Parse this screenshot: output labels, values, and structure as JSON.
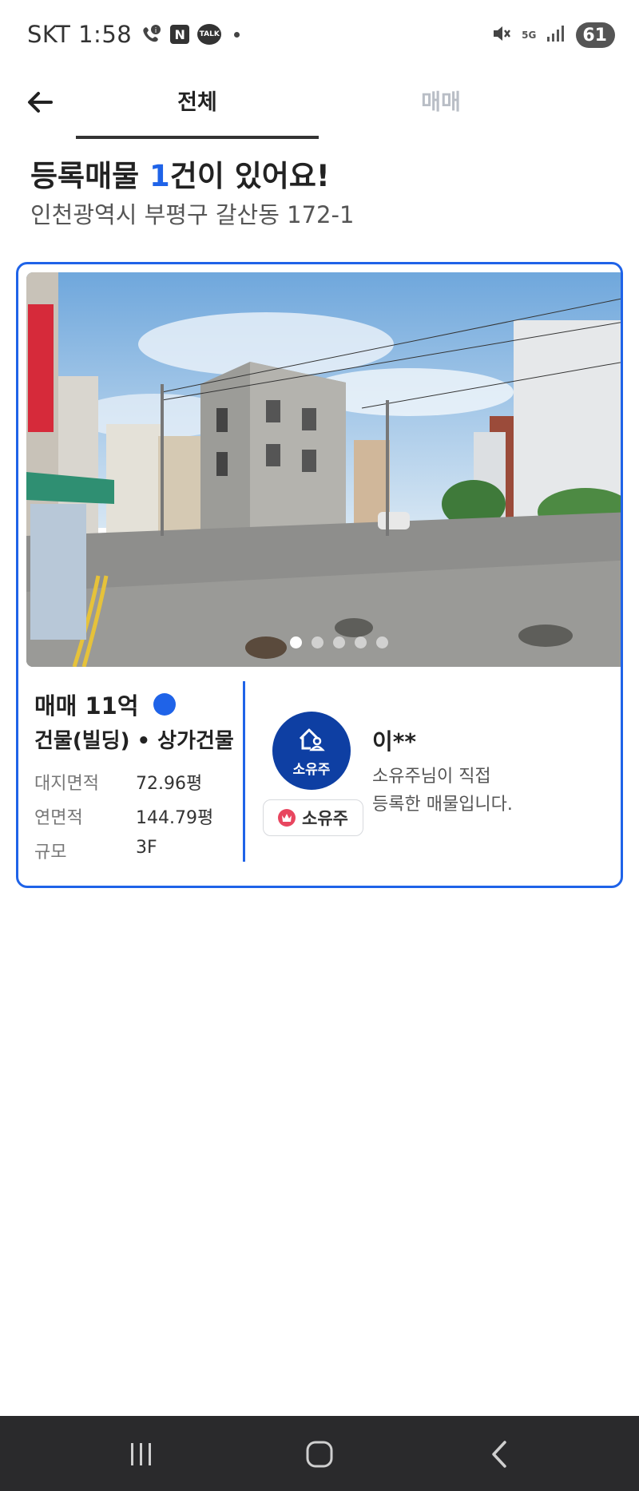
{
  "status_bar": {
    "carrier_time": "SKT 1:58",
    "naver_icon_text": "N",
    "talk_icon_text": "TALK",
    "network": "5G",
    "battery": "61"
  },
  "header": {
    "tabs": [
      {
        "label": "전체",
        "active": true
      },
      {
        "label": "매매",
        "active": false
      }
    ]
  },
  "summary": {
    "title_prefix": "등록매물 ",
    "title_count": "1",
    "title_suffix": "건이 있어요!",
    "address": "인천광역시 부평구 갈산동 172-1"
  },
  "listing": {
    "photo_count": 5,
    "active_photo": 0,
    "price": "매매 11억",
    "property_type": "건물(빌딩) • 상가건물",
    "specs": [
      {
        "label": "대지면적",
        "value": "72.96평"
      },
      {
        "label": "연면적",
        "value": "144.79평"
      },
      {
        "label": "규모",
        "value": "3F"
      }
    ],
    "owner": {
      "circle_label": "소유주",
      "badge_label": "소유주",
      "name": "이**",
      "description_line1": "소유주님이 직접",
      "description_line2": "등록한 매물입니다."
    }
  },
  "colors": {
    "accent": "#1f63e8",
    "owner_circle": "#0e3fa3",
    "crown_badge": "#e8465f",
    "nav_bar": "#2a2a2c"
  },
  "icons": [
    "back-arrow-icon",
    "house-person-icon",
    "crown-icon",
    "recent-apps-icon",
    "home-icon",
    "nav-back-icon"
  ]
}
